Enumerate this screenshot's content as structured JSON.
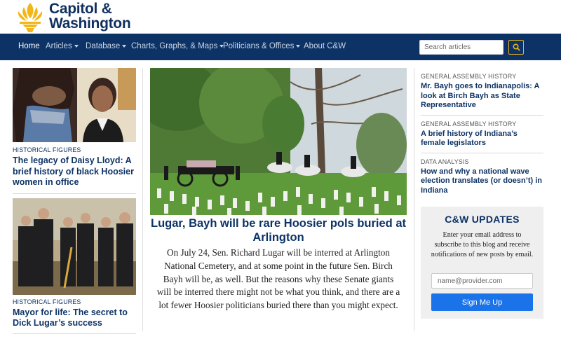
{
  "logo": {
    "line1": "Capitol &",
    "line2": "Washington",
    "icon": "torch-flame-icon"
  },
  "nav": {
    "items": [
      {
        "label": "Home",
        "active": true,
        "dropdown": false
      },
      {
        "label": "Articles",
        "dropdown": true
      },
      {
        "label": "Database",
        "dropdown": true
      },
      {
        "label": "Charts, Graphs, & Maps",
        "dropdown": true
      },
      {
        "label": "Politicians & Offices",
        "dropdown": true
      },
      {
        "label": "About C&W",
        "dropdown": false
      }
    ],
    "search_placeholder": "Search articles",
    "search_icon": "search-icon"
  },
  "left": [
    {
      "category": "HISTORICAL FIGURES",
      "title": "The legacy of Daisy Lloyd: A brief history of black Hoosier women in office"
    },
    {
      "category": "HISTORICAL FIGURES",
      "title": "Mayor for life: The secret to Dick Lugar’s success"
    }
  ],
  "featured": {
    "title": "Lugar, Bayh will be rare Hoosier pols buried at Arlington",
    "body": "On July 24, Sen. Richard Lugar will be interred at Arlington National Cemetery, and at some point in the future Sen. Birch Bayh will be, as well. But the reasons why these Senate giants will be interred there might not be what you think, and there are a lot fewer Hoosier politicians buried there than you might expect."
  },
  "right": [
    {
      "category": "GENERAL ASSEMBLY HISTORY",
      "title": "Mr. Bayh goes to Indianapolis: A look at Birch Bayh as State Representative"
    },
    {
      "category": "GENERAL ASSEMBLY HISTORY",
      "title": "A brief history of Indiana’s female legislators"
    },
    {
      "category": "DATA ANALYSIS",
      "title": "How and why a national wave election translates (or doesn’t) in Indiana"
    }
  ],
  "updates": {
    "title": "C&W UPDATES",
    "text": "Enter your email address to subscribe to this blog and receive notifications of new posts by email.",
    "email_placeholder": "name@provider.com",
    "button_label": "Sign Me Up"
  },
  "colors": {
    "brand_navy": "#0d3366",
    "accent_gold": "#e9b21c",
    "button_blue": "#1a73e8"
  }
}
